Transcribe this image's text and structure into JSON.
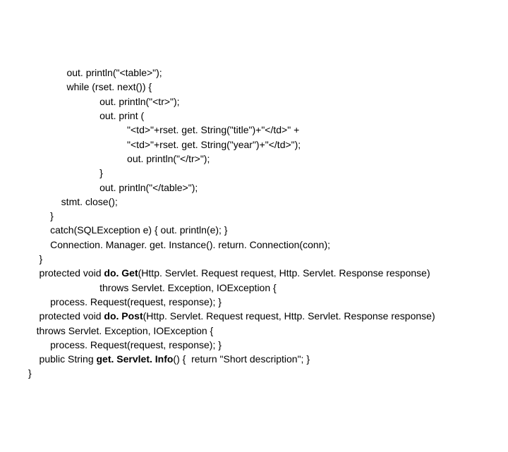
{
  "chart_data": null,
  "code": {
    "lines": [
      {
        "indent": 14,
        "pre": "out. println(\"<table>\"); ",
        "bold": "",
        "post": ""
      },
      {
        "indent": 14,
        "pre": "while (rset. next()) {",
        "bold": "",
        "post": ""
      },
      {
        "indent": 26,
        "pre": "out. println(\"<tr>\"); ",
        "bold": "",
        "post": ""
      },
      {
        "indent": 26,
        "pre": "out. print (",
        "bold": "",
        "post": ""
      },
      {
        "indent": 36,
        "pre": "\"<td>\"+rset. get. String(\"title\")+\"</td>\" +",
        "bold": "",
        "post": ""
      },
      {
        "indent": 36,
        "pre": "\"<td>\"+rset. get. String(\"year\")+\"</td>\"); ",
        "bold": "",
        "post": ""
      },
      {
        "indent": 36,
        "pre": "out. println(\"</tr>\"); ",
        "bold": "",
        "post": ""
      },
      {
        "indent": 26,
        "pre": "}",
        "bold": "",
        "post": ""
      },
      {
        "indent": 26,
        "pre": "out. println(\"</table>\"); ",
        "bold": "",
        "post": ""
      },
      {
        "indent": 12,
        "pre": "stmt. close();",
        "bold": "",
        "post": ""
      },
      {
        "indent": 8,
        "pre": "}",
        "bold": "",
        "post": ""
      },
      {
        "indent": 8,
        "pre": "catch(SQLException e) { out. println(e); }",
        "bold": "",
        "post": ""
      },
      {
        "indent": 8,
        "pre": "Connection. Manager. get. Instance(). return. Connection(conn);",
        "bold": "",
        "post": ""
      },
      {
        "indent": 4,
        "pre": "}",
        "bold": "",
        "post": ""
      },
      {
        "indent": 4,
        "pre": "protected void ",
        "bold": "do. Get",
        "post": "(Http. Servlet. Request request, Http. Servlet. Response response)"
      },
      {
        "indent": 26,
        "pre": "throws Servlet. Exception, IOException {",
        "bold": "",
        "post": ""
      },
      {
        "indent": 8,
        "pre": "process. Request(request, response); }",
        "bold": "",
        "post": ""
      },
      {
        "indent": 4,
        "pre": "protected void ",
        "bold": "do. Post",
        "post": "(Http. Servlet. Request request, Http. Servlet. Response response)"
      },
      {
        "indent": 3,
        "pre": "throws Servlet. Exception, IOException {",
        "bold": "",
        "post": ""
      },
      {
        "indent": 8,
        "pre": "process. Request(request, response); }",
        "bold": "",
        "post": ""
      },
      {
        "indent": 4,
        "pre": "public String ",
        "bold": "get. Servlet. Info",
        "post": "() {  return \"Short description\"; }"
      },
      {
        "indent": 0,
        "pre": "}",
        "bold": "",
        "post": ""
      }
    ]
  }
}
